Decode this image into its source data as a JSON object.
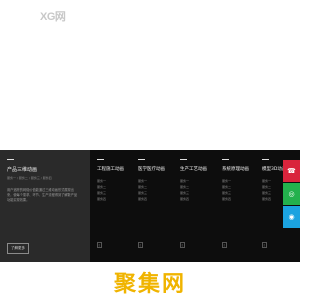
{
  "header": {
    "logo": "XG网"
  },
  "featured": {
    "title": "产品三维动画",
    "subs": "服务一 / 服务二 / 服务三 / 服务四",
    "description": "用户追踪的网络价值能通过三维动画形式展现出来，使每个需求、环节、生产流程得到了解数产品功能实现效果。",
    "more_button": "了解更多"
  },
  "columns": [
    {
      "title": "工程施工动画",
      "items": [
        "服务一",
        "服务二",
        "服务三",
        "服务四"
      ],
      "icon": "▯"
    },
    {
      "title": "医学医疗动画",
      "items": [
        "服务一",
        "服务二",
        "服务三",
        "服务四"
      ],
      "icon": "▯"
    },
    {
      "title": "生产工艺动画",
      "items": [
        "服务一",
        "服务二",
        "服务三",
        "服务四"
      ],
      "icon": "▯"
    },
    {
      "title": "系统原理动画",
      "items": [
        "服务一",
        "服务二",
        "服务三",
        "服务四"
      ],
      "icon": "▯"
    },
    {
      "title": "模型3D动画",
      "items": [
        "服务一",
        "服务二",
        "服务三",
        "服务四"
      ],
      "icon": "▯"
    }
  ],
  "side_buttons": [
    {
      "icon": "phone-icon",
      "glyph": "☎",
      "color": "#d9243c"
    },
    {
      "icon": "wechat-icon",
      "glyph": "◎",
      "color": "#23b14d"
    },
    {
      "icon": "qq-icon",
      "glyph": "◉",
      "color": "#1ba3e0"
    }
  ],
  "watermark": "聚集网"
}
